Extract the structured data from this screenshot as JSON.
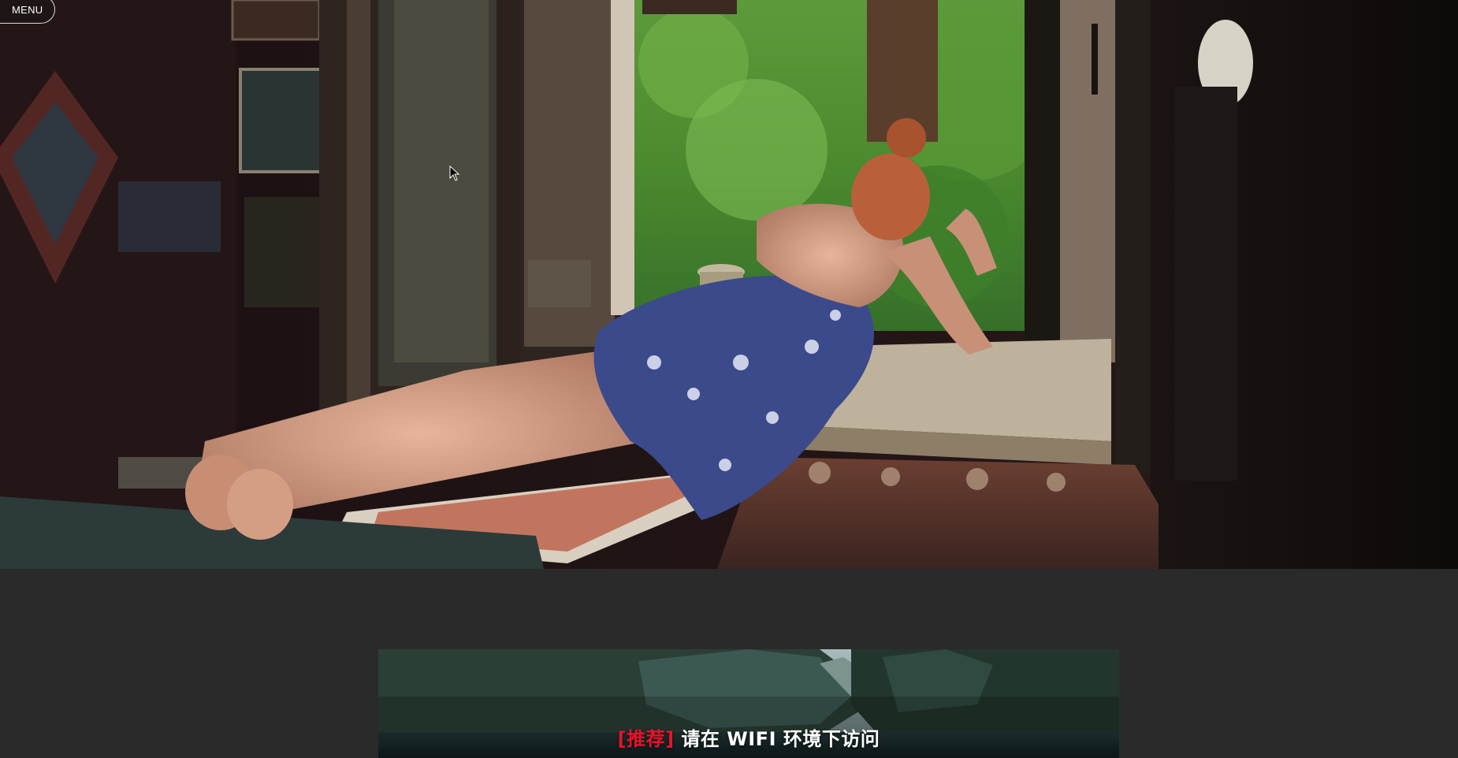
{
  "menu": {
    "label": "MENU"
  },
  "hero": {
    "alt": ""
  },
  "feature_card": {
    "tag": "[推荐]",
    "text": " 请在 WIFI 环境下访问"
  },
  "colors": {
    "background": "#2b2a2b",
    "tag_red": "#e8132b",
    "title_white": "#ffffff"
  },
  "icons": [
    "mouse-cursor-icon"
  ]
}
